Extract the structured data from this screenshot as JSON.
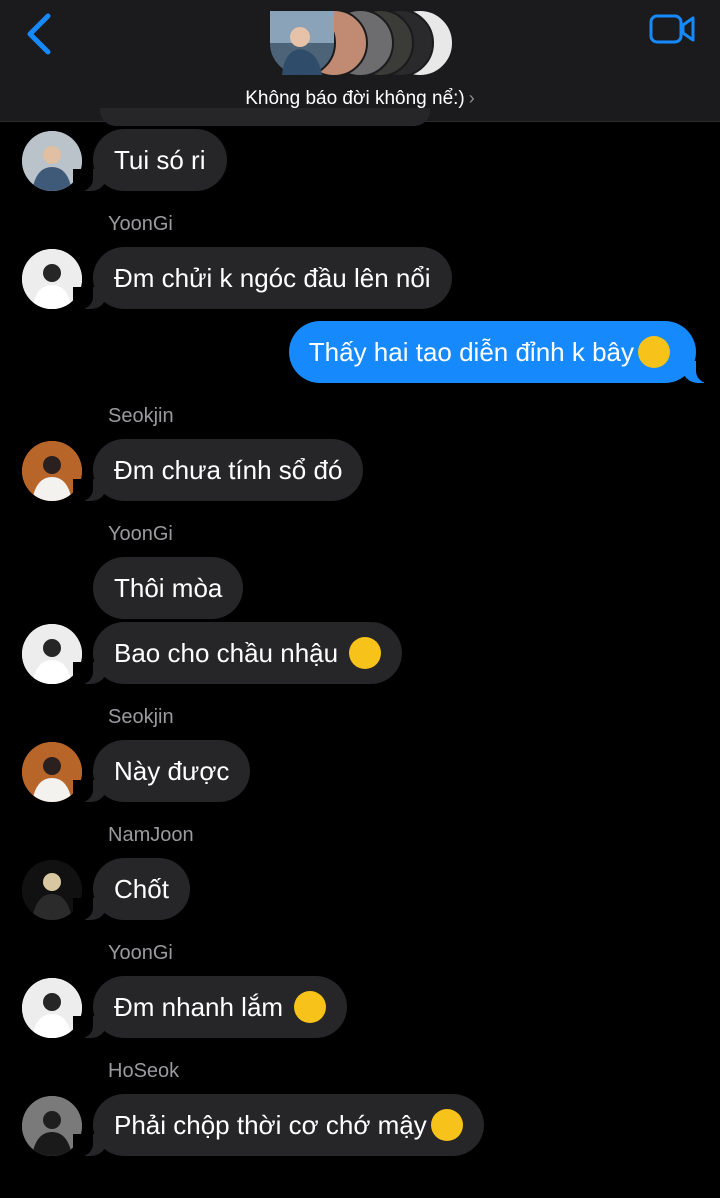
{
  "header": {
    "group_name": "Không báo đời không nể:)",
    "chevron": "›",
    "back_icon": "chevron-left-icon",
    "video_icon": "video-camera-icon",
    "accent": "#1689fc"
  },
  "messages": [
    {
      "sender": "",
      "text": "Tui só ri",
      "emoji": null
    },
    {
      "sender": "YoonGi",
      "text": "Đm chửi k ngóc đầu lên nổi",
      "emoji": null
    },
    {
      "sender": "",
      "text": "Thấy hai tao diễn đỉnh k bây",
      "emoji": "kissing-face"
    },
    {
      "sender": "Seokjin",
      "text": "Đm chưa tính sổ đó",
      "emoji": null
    },
    {
      "sender": "YoonGi",
      "text": "Thôi mòa",
      "emoji": null
    },
    {
      "sender": "",
      "text": "Bao cho chầu nhậu ",
      "emoji": "winking-face"
    },
    {
      "sender": "Seokjin",
      "text": "Này được",
      "emoji": null
    },
    {
      "sender": "NamJoon",
      "text": "Chốt",
      "emoji": null
    },
    {
      "sender": "YoonGi",
      "text": "Đm nhanh lắm ",
      "emoji": "face-with-rolling-eyes"
    },
    {
      "sender": "HoSeok",
      "text": "Phải chộp thời cơ chớ mậy",
      "emoji": "kissing-face-with-closed-eyes"
    }
  ],
  "colors": {
    "incoming_bubble": "#262628",
    "outgoing_bubble": "#1689fc",
    "header_bg": "#1b1b1d",
    "sender_text": "#9a9a9f"
  }
}
